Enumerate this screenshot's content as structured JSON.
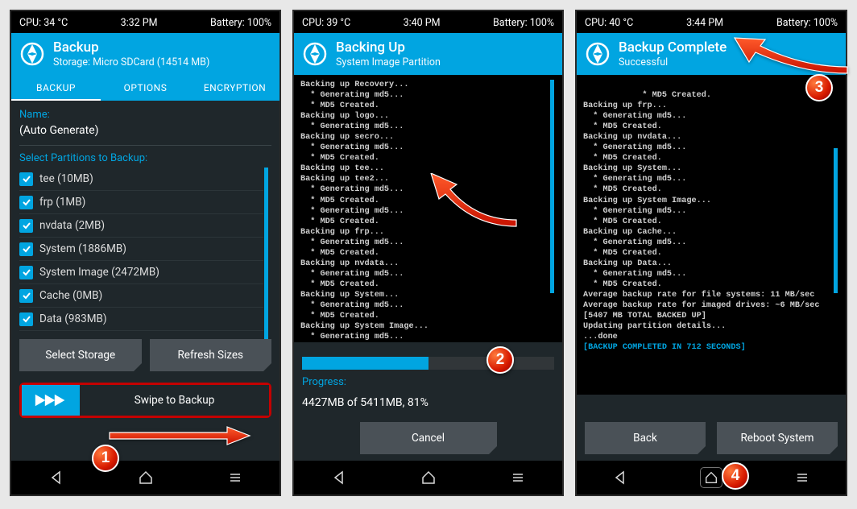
{
  "screens": [
    {
      "status": {
        "cpu": "CPU: 34 °C",
        "time": "3:32 PM",
        "battery": "Battery: 100%"
      },
      "header": {
        "title": "Backup",
        "sub": "Storage: Micro SDCard (14514 MB)"
      },
      "tabs": [
        "BACKUP",
        "OPTIONS",
        "ENCRYPTION"
      ],
      "active_tab": 0,
      "name_label": "Name:",
      "name_value": "(Auto Generate)",
      "partitions_label": "Select Partitions to Backup:",
      "partitions": [
        "tee (10MB)",
        "frp (1MB)",
        "nvdata (2MB)",
        "System (1886MB)",
        "System Image (2472MB)",
        "Cache (0MB)",
        "Data (983MB)"
      ],
      "btn_storage": "Select Storage",
      "btn_refresh": "Refresh Sizes",
      "swipe_label": "Swipe to Backup"
    },
    {
      "status": {
        "cpu": "CPU: 39 °C",
        "time": "3:40 PM",
        "battery": "Battery: 100%"
      },
      "header": {
        "title": "Backing Up",
        "sub": "System Image Partition"
      },
      "log": "Backing up Recovery...\n  * Generating md5...\n  * MD5 Created.\nBacking up logo...\n  * Generating md5...\nBacking up secro...\n  * Generating md5...\n  * MD5 Created.\nBacking up tee...\nBacking up tee2...\n  * Generating md5...\n  * MD5 Created.\n  * Generating md5...\n  * MD5 Created.\nBacking up frp...\n  * Generating md5...\n  * MD5 Created.\nBacking up nvdata...\n  * Generating md5...\n  * MD5 Created.\nBacking up System...\n  * Generating md5...\n  * MD5 Created.\nBacking up System Image...\n  * Generating md5...",
      "progress_pct": 50,
      "progress_label": "Progress:",
      "progress_text": "4427MB of 5411MB, 81%",
      "btn_cancel": "Cancel"
    },
    {
      "status": {
        "cpu": "CPU: 40 °C",
        "time": "3:44 PM",
        "battery": "Battery: 100%"
      },
      "header": {
        "title": "Backup Complete",
        "sub": "Successful"
      },
      "log": "  * MD5 Created.\nBacking up frp...\n  * Generating md5...\n  * MD5 Created.\nBacking up nvdata...\n  * Generating md5...\n  * MD5 Created.\nBacking up System...\n  * Generating md5...\n  * MD5 Created.\nBacking up System Image...\n  * Generating md5...\n  * MD5 Created.\nBacking up Cache...\n  * Generating md5...\n  * MD5 Created.\nBacking up Data...\n  * Generating md5...\n  * MD5 Created.\nAverage backup rate for file systems: 11 MB/sec\nAverage backup rate for imaged drives: ~6 MB/sec\n[5407 MB TOTAL BACKED UP]\nUpdating partition details...\n...done",
      "log_done": "[BACKUP COMPLETED IN 712 SECONDS]",
      "btn_back": "Back",
      "btn_reboot": "Reboot System"
    }
  ],
  "badges": [
    "1",
    "2",
    "3",
    "4"
  ]
}
